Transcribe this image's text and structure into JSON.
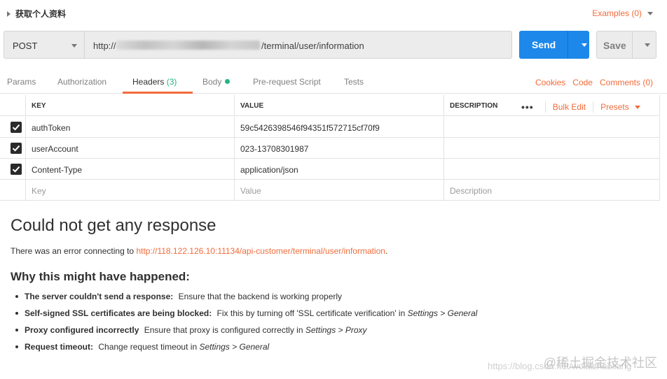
{
  "request": {
    "name": "获取个人资料",
    "examples_label": "Examples (0)"
  },
  "url_bar": {
    "method": "POST",
    "url_prefix": "http://",
    "url_suffix": "/terminal/user/information",
    "send_label": "Send",
    "save_label": "Save"
  },
  "tabs": [
    {
      "label": "Params"
    },
    {
      "label": "Authorization"
    },
    {
      "label": "Headers",
      "count": "(3)"
    },
    {
      "label": "Body"
    },
    {
      "label": "Pre-request Script"
    },
    {
      "label": "Tests"
    }
  ],
  "tab_links": {
    "cookies": "Cookies",
    "code": "Code",
    "comments": "Comments (0)"
  },
  "headers_table": {
    "columns": [
      "KEY",
      "VALUE",
      "DESCRIPTION"
    ],
    "more_icon": "•••",
    "bulk_edit": "Bulk Edit",
    "presets": "Presets",
    "rows": [
      {
        "key": "authToken",
        "value": "59c5426398546f94351f572715cf70f9",
        "description": ""
      },
      {
        "key": "userAccount",
        "value": "023-13708301987",
        "description": ""
      },
      {
        "key": "Content-Type",
        "value": "application/json",
        "description": ""
      }
    ],
    "placeholders": {
      "key": "Key",
      "value": "Value",
      "description": "Description"
    }
  },
  "response": {
    "title": "Could not get any response",
    "error_prefix": "There was an error connecting to ",
    "error_url": "http://118.122.126.10:11134/api-customer/terminal/user/information",
    "error_suffix": ".",
    "why_heading": "Why this might have happened:",
    "reasons": [
      {
        "bold": "The server couldn't send a response:",
        "text": "Ensure that the backend is working properly",
        "italic": "",
        "tail": ""
      },
      {
        "bold": "Self-signed SSL certificates are being blocked:",
        "text": "Fix this by turning off 'SSL certificate verification' in ",
        "italic": "Settings > General",
        "tail": ""
      },
      {
        "bold": "Proxy configured incorrectly",
        "text": "Ensure that proxy is configured correctly in ",
        "italic": "Settings > Proxy",
        "tail": ""
      },
      {
        "bold": "Request timeout:",
        "text": "Change request timeout in ",
        "italic": "Settings > General",
        "tail": ""
      }
    ]
  },
  "watermark": {
    "text": "@稀土掘金技术社区",
    "url": "https://blog.csdn.net/wolaizhaoliang"
  },
  "colors": {
    "accent": "#f26b3a",
    "send_blue": "#1d88ea",
    "active_green": "#26b47f"
  }
}
